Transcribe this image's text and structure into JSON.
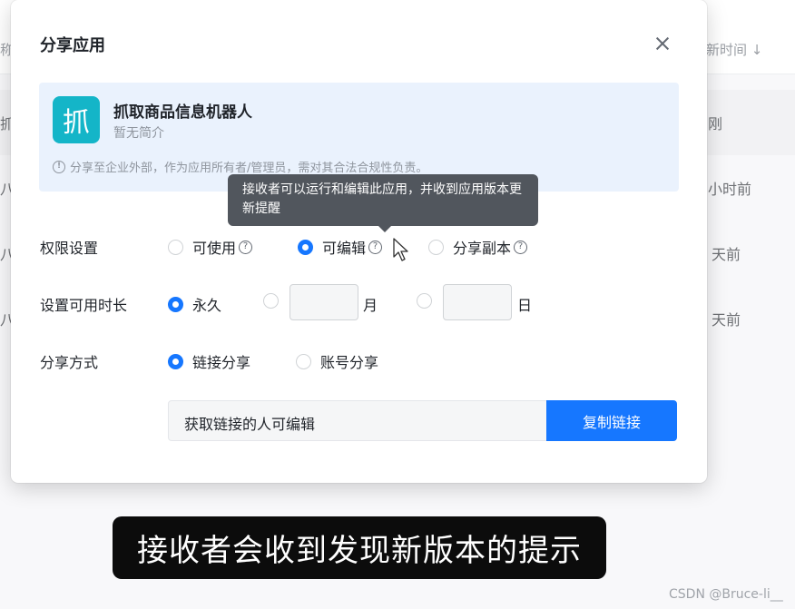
{
  "background": {
    "header_left": "称",
    "header_right": "新时间 ↓",
    "rows": [
      {
        "left": "抓",
        "right": "刚"
      },
      {
        "left": "八",
        "right": "小时前"
      },
      {
        "left": "八",
        "right": "天前"
      },
      {
        "left": "八",
        "right": "天前"
      }
    ]
  },
  "modal": {
    "title": "分享应用",
    "close_icon": "close-icon",
    "app": {
      "icon_char": "抓",
      "name": "抓取商品信息机器人",
      "description": "暂无简介",
      "notice": "分享至企业外部，作为应用所有者/管理员，需对其合法合规性负责。"
    },
    "tooltip": "接收者可以运行和编辑此应用，并收到应用版本更新提醒",
    "permission": {
      "label": "权限设置",
      "options": [
        {
          "label": "可使用",
          "checked": false
        },
        {
          "label": "可编辑",
          "checked": true
        },
        {
          "label": "分享副本",
          "checked": false
        }
      ],
      "help_icon": "question-circle-icon"
    },
    "duration": {
      "label": "设置可用时长",
      "forever": "永久",
      "month_unit": "月",
      "day_unit": "日",
      "month_value": "",
      "day_value": ""
    },
    "share_method": {
      "label": "分享方式",
      "options": [
        {
          "label": "链接分享",
          "checked": true
        },
        {
          "label": "账号分享",
          "checked": false
        }
      ]
    },
    "link_text": "获取链接的人可编辑",
    "copy_button": "复制链接"
  },
  "subtitle": "接收者会收到发现新版本的提示",
  "watermark": "CSDN @Bruce-li__",
  "colors": {
    "accent": "#1677ff",
    "app_icon_bg": "#14b5c8",
    "card_bg": "#eaf2fd",
    "tooltip_bg": "#51565d"
  }
}
